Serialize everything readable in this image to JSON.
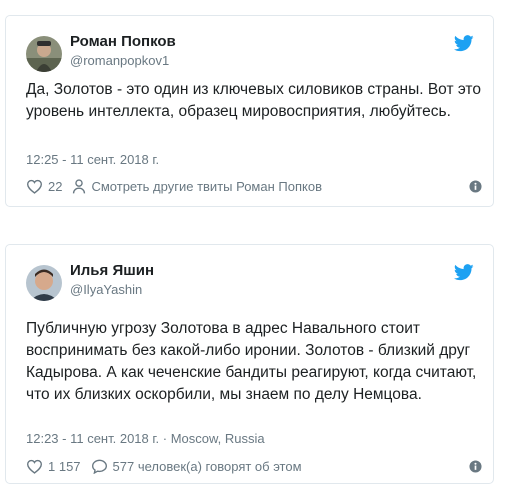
{
  "tweets": [
    {
      "name": "Роман Попков",
      "handle": "@romanpopkov1",
      "text": "Да, Золотов - это один из ключевых силовиков страны. Вот это уровень интеллекта, образец мировосприятия, любуйтесь.",
      "timestamp": "12:25 - 11 сент. 2018 г.",
      "likes": "22",
      "secondary_action": "Смотреть другие твиты Роман Попков",
      "icons": {
        "like": "heart-icon",
        "secondary": "person-icon",
        "brand": "twitter-bird-icon",
        "info": "info-icon"
      }
    },
    {
      "name": "Илья Яшин",
      "handle": "@IlyaYashin",
      "text": "Публичную угрозу Золотова в адрес Навального стоит воспринимать без какой-либо иронии. Золотов - близкий друг Кадырова. А как чеченские бандиты реагируют, когда считают, что их близких оскорбили, мы знаем по делу Немцова.",
      "timestamp": "12:23 - 11 сент. 2018 г. · Moscow, Russia",
      "likes": "1 157",
      "secondary_action": "577 человек(а) говорят об этом",
      "icons": {
        "like": "heart-icon",
        "secondary": "speech-bubble-icon",
        "brand": "twitter-bird-icon",
        "info": "info-icon"
      }
    }
  ],
  "colors": {
    "twitter_blue": "#1da1f2",
    "secondary_text": "#697882",
    "primary_text": "#1c2022",
    "border": "#e1e8ed"
  }
}
